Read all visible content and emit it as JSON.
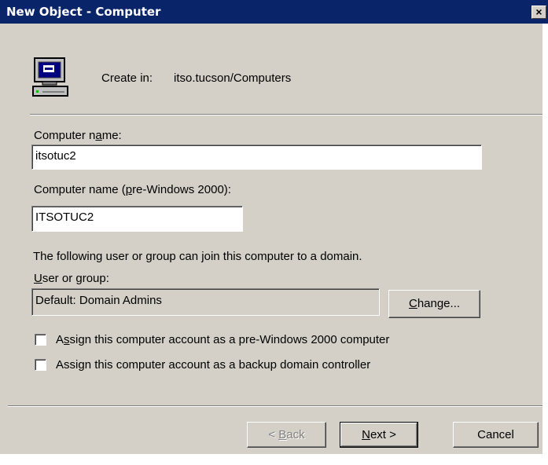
{
  "window": {
    "title": "New Object - Computer",
    "close_glyph": "×"
  },
  "header": {
    "create_in_label": "Create in:",
    "create_in_value": "itso.tucson/Computers",
    "icon": "computer-icon"
  },
  "computer_name": {
    "label_pre": "Computer n",
    "label_accel": "a",
    "label_post": "me:",
    "value": "itsotuc2"
  },
  "pre_win2000_name": {
    "label_pre": "Computer name (",
    "label_accel": "p",
    "label_post": "re-Windows 2000):",
    "value": "ITSOTUC2"
  },
  "join_info": {
    "text": "The following user or group can join this computer to a domain."
  },
  "user_group": {
    "label_accel": "U",
    "label_post": "ser or group:",
    "value": "Default: Domain Admins",
    "change_accel": "C",
    "change_post": "hange..."
  },
  "options": [
    {
      "label_pre": "A",
      "label_accel": "s",
      "label_post": "sign this computer account as a pre-Windows 2000 computer",
      "checked": false
    },
    {
      "label_pre": "Assi",
      "label_accel": "g",
      "label_post": "n this computer account as a backup domain controller",
      "checked": false
    }
  ],
  "footer": {
    "back": {
      "pre": "< ",
      "accel": "B",
      "post": "ack",
      "enabled": false
    },
    "next": {
      "accel": "N",
      "post": "ext >",
      "enabled": true
    },
    "cancel": {
      "label": "Cancel",
      "enabled": true
    }
  },
  "colors": {
    "titlebar": "#0a246a",
    "dialog_face": "#d4d0c8",
    "disabled_text": "#808080"
  }
}
